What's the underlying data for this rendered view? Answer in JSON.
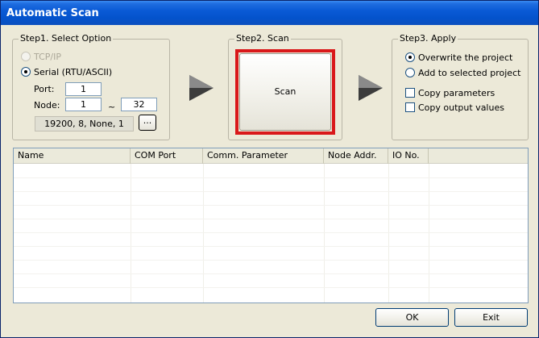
{
  "window": {
    "title": "Automatic Scan"
  },
  "step1": {
    "label": "Step1. Select Option",
    "tcpip_label": "TCP/IP",
    "serial_label": "Serial (RTU/ASCII)",
    "port_label": "Port:",
    "port_value": "1",
    "node_label": "Node:",
    "node_from": "1",
    "node_sep": "~",
    "node_to": "32",
    "comm_params": "19200, 8, None, 1",
    "browse_label": "..."
  },
  "step2": {
    "label": "Step2. Scan",
    "scan_button": "Scan"
  },
  "step3": {
    "label": "Step3. Apply",
    "overwrite_label": "Overwrite the project",
    "add_label": "Add to selected project",
    "copy_params_label": "Copy parameters",
    "copy_output_label": "Copy output values"
  },
  "table": {
    "columns": [
      "Name",
      "COM Port",
      "Comm. Parameter",
      "Node Addr.",
      "IO No."
    ]
  },
  "footer": {
    "ok_label": "OK",
    "exit_label": "Exit"
  }
}
